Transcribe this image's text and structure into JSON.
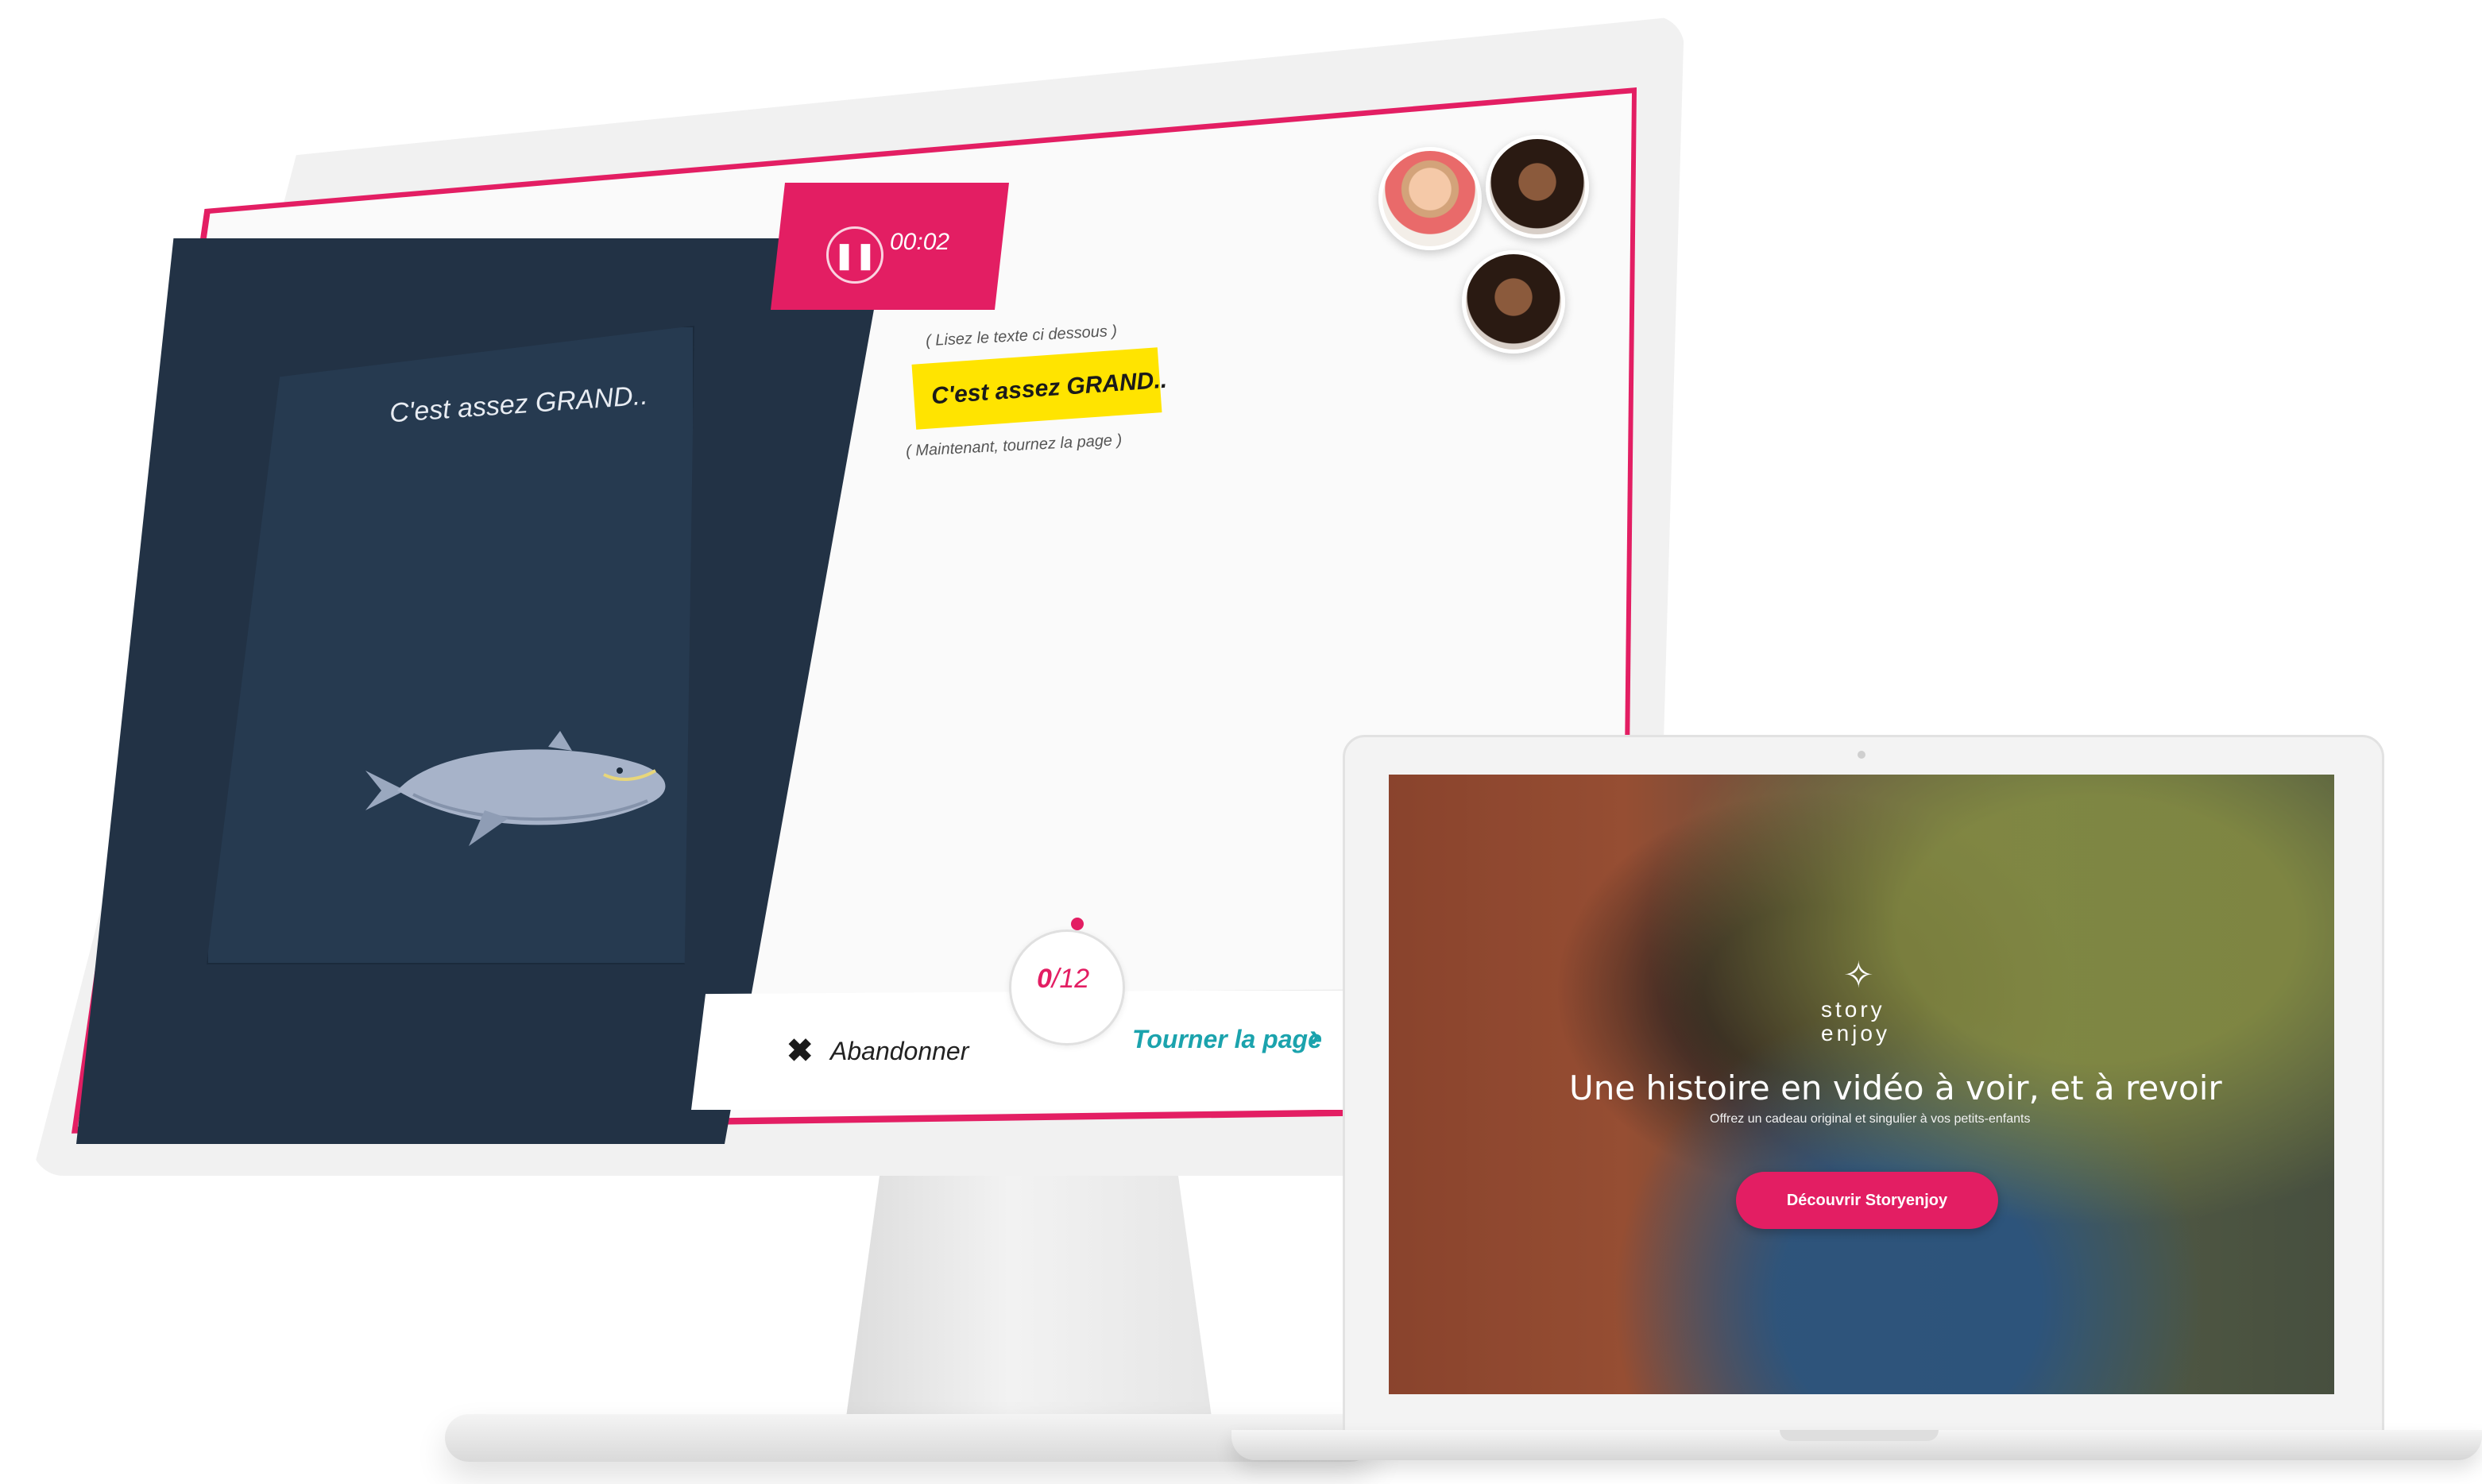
{
  "player": {
    "timer": "00:02",
    "pause_icon": "pause-icon",
    "art_caption": "C'est assez GRAND..",
    "instruction_top": "( Lisez le texte ci dessous )",
    "highlight_text": "C'est assez GRAND..",
    "instruction_bottom": "( Maintenant, tournez la page )",
    "progress_current": "0",
    "progress_total": "/12",
    "abandon_label": "Abandonner",
    "abandon_icon": "close-icon",
    "turn_label": "Tourner la page",
    "turn_icon": "chevron-right-icon",
    "accent_color": "#e31e63",
    "teal_color": "#1ba3ad"
  },
  "landing": {
    "logo_line1": "story",
    "logo_line2": "enjoy",
    "logo_icon": "crane-icon",
    "title": "Une histoire en vidéo à voir, et à revoir",
    "subtitle": "Offrez un cadeau original et singulier à vos petits-enfants",
    "cta": "Découvrir Storyenjoy",
    "accent_color": "#e31e63"
  }
}
